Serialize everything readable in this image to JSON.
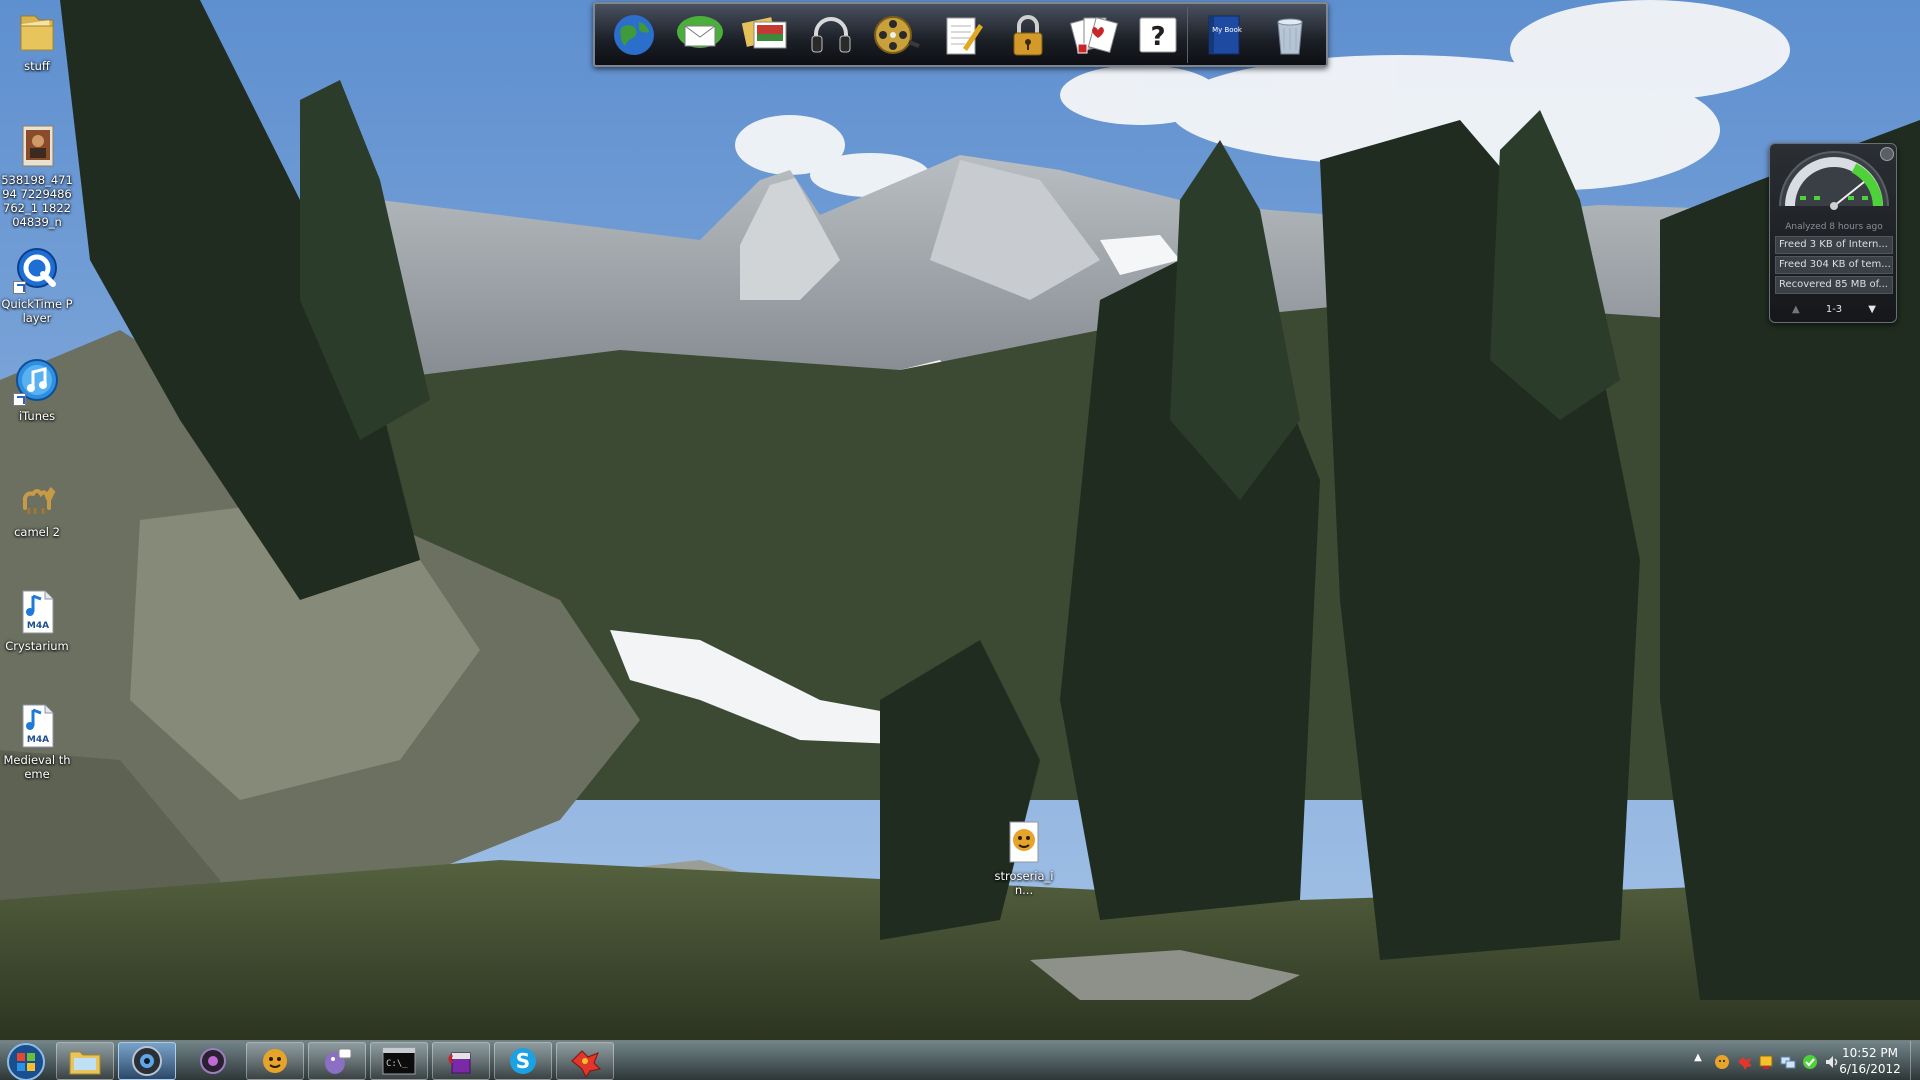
{
  "desktop": {
    "icons": [
      {
        "label": "stuff",
        "kind": "folder-icon"
      },
      {
        "label": "538198_47194 7229486762_1 182204839_n",
        "kind": "image-file-icon"
      },
      {
        "label": "QuickTime Player",
        "kind": "quicktime-icon"
      },
      {
        "label": "iTunes",
        "kind": "itunes-icon"
      },
      {
        "label": "camel 2",
        "kind": "camel-icon"
      },
      {
        "label": "Crystarium",
        "kind": "m4a-file-icon",
        "badge": "M4A"
      },
      {
        "label": "Medieval theme",
        "kind": "m4a-file-icon",
        "badge": "M4A"
      },
      {
        "label": "stroseria_in...",
        "kind": "app-icon"
      }
    ]
  },
  "dock": {
    "items": [
      "globe-icon",
      "mail-icon",
      "photos-icon",
      "headphones-icon",
      "film-reel-icon",
      "notepad-icon",
      "lock-icon",
      "playing-cards-icon",
      "help-icon",
      "my-book-icon",
      "recycle-bin-icon"
    ],
    "help_glyph": "?",
    "mybook_text": "My Book"
  },
  "gadget": {
    "analyzed": "Analyzed 8 hours ago",
    "entries": [
      "Freed 3 KB of Intern...",
      "Freed 304 KB of tem...",
      "Recovered 85 MB of..."
    ],
    "pager": "1-3",
    "pager_prev": "▲",
    "pager_next": "▼"
  },
  "taskbar": {
    "buttons": [
      "windows-explorer-icon",
      "webcam-icon",
      "media-orb-icon",
      "cartoon-app-icon",
      "pidgin-icon",
      "command-prompt-icon",
      "paint-can-icon",
      "skype-icon",
      "game-app-icon"
    ],
    "skype_glyph": "S",
    "cmd_glyph": "C:\\_"
  },
  "tray": {
    "show_hidden": "▲",
    "time": "10:52 PM",
    "date": "6/16/2012"
  },
  "colors": {
    "sky": "#6f9bd1",
    "accent_blue": "#2a62c9",
    "gadget_green": "#4fd13a"
  }
}
